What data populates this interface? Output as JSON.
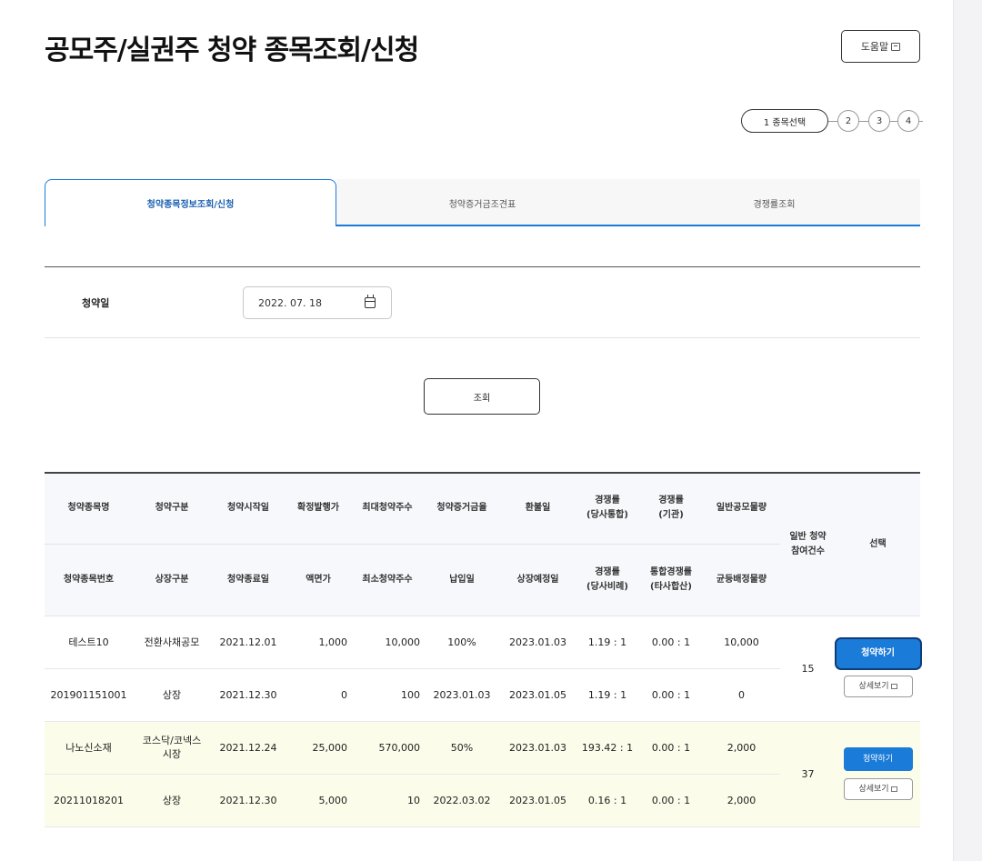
{
  "page": {
    "title": "공모주/실권주 청약 종목조회/신청",
    "help_label": "도움말"
  },
  "steps": {
    "active": "1 종목선택",
    "others": [
      "2",
      "3",
      "4"
    ]
  },
  "tabs": [
    {
      "label": "청약종목정보조회/신청"
    },
    {
      "label": "청약증거금조견표"
    },
    {
      "label": "경쟁률조회"
    }
  ],
  "filter": {
    "date_label": "청약일",
    "date_value": "2022. 07. 18",
    "search_label": "조회"
  },
  "table": {
    "header_row1": [
      "청약종목명",
      "청약구분",
      "청약시작일",
      "확정발행가",
      "최대청약주수",
      "청약증거금율",
      "환불일",
      "경쟁률\n(당사통합)",
      "경쟁률\n(기관)",
      "일반공모물량"
    ],
    "header_row2": [
      "청약종목번호",
      "상장구분",
      "청약종료일",
      "액면가",
      "최소청약주수",
      "납입일",
      "상장예정일",
      "경쟁률\n(당사비례)",
      "통합경쟁률\n(타사합산)",
      "균등배정물량"
    ],
    "header_count": "일반 청약\n참여건수",
    "header_select": "선택",
    "rows": [
      {
        "top": [
          "테스트10",
          "전환사채공모",
          "2021.12.01",
          "1,000",
          "10,000",
          "100%",
          "2023.01.03",
          "1.19 : 1",
          "0.00 : 1",
          "10,000"
        ],
        "bottom": [
          "201901151001",
          "상장",
          "2021.12.30",
          "0",
          "100",
          "2023.01.03",
          "2023.01.05",
          "1.19 : 1",
          "0.00 : 1",
          "0"
        ],
        "count": "15",
        "apply_label": "청약하기",
        "detail_label": "상세보기"
      },
      {
        "top": [
          "나노신소재",
          "코스닥/코넥스\n시장",
          "2021.12.24",
          "25,000",
          "570,000",
          "50%",
          "2023.01.03",
          "193.42 : 1",
          "0.00 : 1",
          "2,000"
        ],
        "bottom": [
          "20211018201",
          "상장",
          "2021.12.30",
          "5,000",
          "10",
          "2022.03.02",
          "2023.01.05",
          "0.16 : 1",
          "0.00 : 1",
          "2,000"
        ],
        "count": "37",
        "apply_label": "청약하기",
        "detail_label": "상세보기"
      }
    ]
  },
  "colors": {
    "accent": "#1a7bd8",
    "highlight_row": "#fbfcea",
    "header_bg": "#f7f8fb"
  }
}
